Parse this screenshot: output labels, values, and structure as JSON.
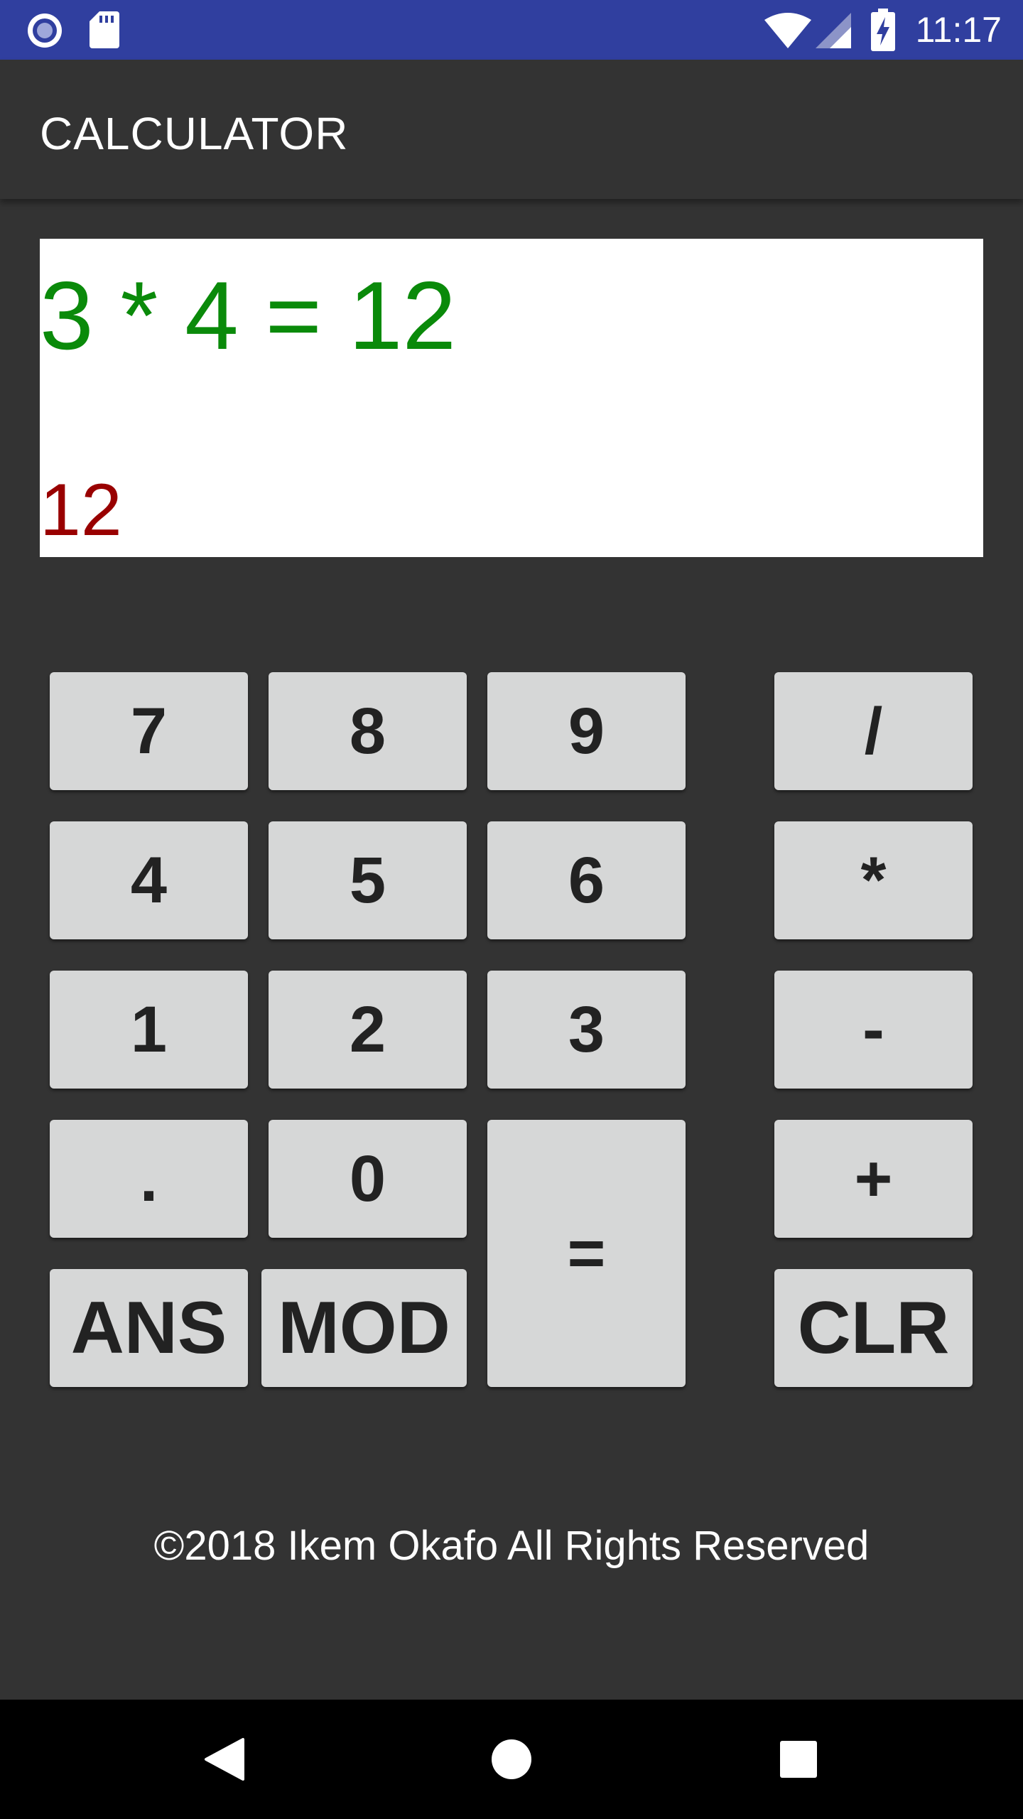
{
  "status_bar": {
    "time": "11:17",
    "icons": [
      "notification-icon",
      "sd-card-icon",
      "wifi-icon",
      "cell-signal-icon",
      "battery-charging-icon"
    ]
  },
  "app_bar": {
    "title": "CALCULATOR"
  },
  "display": {
    "expression": "3 * 4 = 12",
    "answer": "12",
    "expression_color": "#0a8a0a",
    "answer_color": "#990000"
  },
  "keypad": {
    "seven": "7",
    "eight": "8",
    "nine": "9",
    "divide": "/",
    "four": "4",
    "five": "5",
    "six": "6",
    "multiply": "*",
    "one": "1",
    "two": "2",
    "three": "3",
    "subtract": "-",
    "decimal": ".",
    "zero": "0",
    "equals": "=",
    "add": "+",
    "ans": "ANS",
    "mod": "MOD",
    "clear": "CLR"
  },
  "footer": {
    "copyright": "©2018 Ikem Okafo All Rights Reserved"
  },
  "nav_bar": {
    "icons": [
      "back-icon",
      "home-icon",
      "recents-icon"
    ]
  },
  "colors": {
    "status_bar": "#303F9F",
    "background": "#333333",
    "key": "#d6d7d7"
  }
}
